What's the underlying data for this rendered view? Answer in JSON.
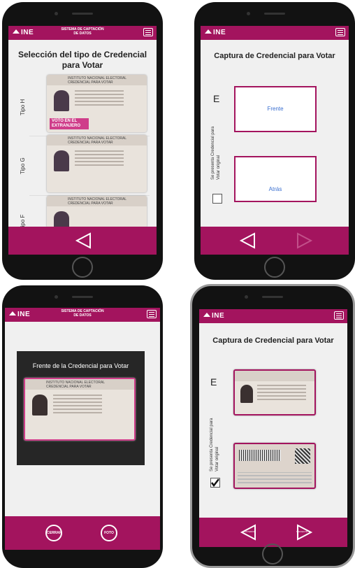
{
  "colors": {
    "brand": "#a3145e",
    "badge": "#cf3d8a",
    "link": "#3a6fd0"
  },
  "header": {
    "logo": "INE",
    "system_line1": "SISTEMA DE CAPTACIÓN",
    "system_line2": "DE DATOS"
  },
  "screen1": {
    "title_line1": "Selección del tipo de Credencial",
    "title_line2": "para Votar",
    "types": [
      {
        "label": "Tipo H",
        "card_line1": "INSTITUTO NACIONAL ELECTORAL",
        "card_line2": "CREDENCIAL PARA VOTAR",
        "badge": "VOTO EN EL EXTRANJERO"
      },
      {
        "label": "Tipo G",
        "card_line1": "INSTITUTO NACIONAL ELECTORAL",
        "card_line2": "CREDENCIAL PARA VOTAR"
      },
      {
        "label": "Tipo F",
        "card_line1": "INSTITUTO NACIONAL ELECTORAL",
        "card_line2": "CREDENCIAL PARA VOTAR"
      }
    ],
    "back_icon": "triangle-left-icon"
  },
  "screen2": {
    "title": "Captura de Credencial para Votar",
    "e_label": "E",
    "side_label": "Se presenta Credencial para Votar original",
    "front_label": "Frente",
    "back_label": "Atrás",
    "checked": false
  },
  "screen3": {
    "camera_label": "Frente de la Credencial para Votar",
    "card_line1": "INSTITUTO NACIONAL ELECTORAL",
    "card_line2": "CREDENCIAL PARA VOTAR",
    "btn_left": "CERRAR",
    "btn_right": "FOTO"
  },
  "screen4": {
    "title": "Captura de Credencial para Votar",
    "e_label": "E",
    "side_label": "Se presenta Credencial para Votar original",
    "checked": true,
    "btn_left": "ANTERIOR",
    "btn_right": "SIGUIENTE"
  }
}
